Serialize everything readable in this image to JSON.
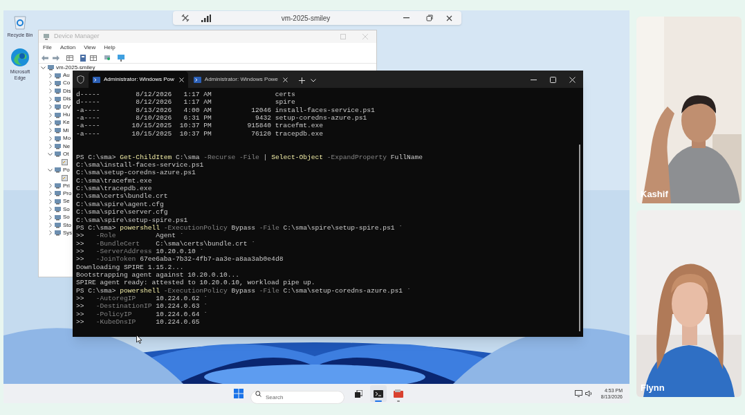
{
  "remote_bar": {
    "title": "vm-2025-smiley"
  },
  "desktop_icons": [
    {
      "kind": "recycle",
      "label": "Recycle Bin"
    },
    {
      "kind": "browser",
      "label": "Microsoft Edge"
    }
  ],
  "device_manager": {
    "title": "Device Manager",
    "menu": [
      "File",
      "Action",
      "View",
      "Help"
    ],
    "tree": {
      "label": "vm-2025-smiley",
      "expanded": true,
      "children": [
        {
          "label": "Au",
          "expanded": false
        },
        {
          "label": "Co",
          "expanded": false
        },
        {
          "label": "Dis",
          "expanded": false
        },
        {
          "label": "Dis",
          "expanded": false
        },
        {
          "label": "DV",
          "expanded": false
        },
        {
          "label": "Hu",
          "expanded": false
        },
        {
          "label": "Ke",
          "expanded": false
        },
        {
          "label": "Mi",
          "expanded": false
        },
        {
          "label": "Mo",
          "expanded": false
        },
        {
          "label": "Ne",
          "expanded": false
        },
        {
          "label": "Ot",
          "expanded": true,
          "children": [
            {
              "kind": "device"
            }
          ]
        },
        {
          "label": "Po",
          "expanded": true,
          "children": [
            {
              "kind": "device"
            }
          ]
        },
        {
          "label": "Pri",
          "expanded": false
        },
        {
          "label": "Pro",
          "expanded": false
        },
        {
          "label": "Se",
          "expanded": false
        },
        {
          "label": "So",
          "expanded": false
        },
        {
          "label": "So",
          "expanded": false
        },
        {
          "label": "Sto",
          "expanded": false
        },
        {
          "label": "Sys",
          "expanded": false
        }
      ]
    }
  },
  "terminal": {
    "tabs": [
      {
        "label": "Administrator: Windows Pow",
        "selected": true
      },
      {
        "label": "Administrator: Windows Powe",
        "selected": false
      }
    ],
    "lines": [
      {
        "kind": "output",
        "text": "d-----         8/12/2026   1:17 AM                certs"
      },
      {
        "kind": "output",
        "text": "d-----         8/12/2026   1:17 AM                spire"
      },
      {
        "kind": "output",
        "text": "-a----         8/13/2026   4:00 AM          12046 install-faces-service.ps1"
      },
      {
        "kind": "output",
        "text": "-a----         8/10/2026   6:31 PM           9432 setup-coredns-azure.ps1"
      },
      {
        "kind": "output",
        "text": "-a----        10/15/2025  10:37 PM         915840 tracefmt.exe"
      },
      {
        "kind": "output",
        "text": "-a----        10/15/2025  10:37 PM          76120 tracepdb.exe"
      },
      {
        "kind": "blank"
      },
      {
        "kind": "blank"
      },
      {
        "kind": "command",
        "segments": [
          {
            "text": "PS C:\\sma> ",
            "kind": "plain"
          },
          {
            "text": "Get-ChildItem",
            "kind": "cmd"
          },
          {
            "text": " C:\\sma ",
            "kind": "plain"
          },
          {
            "text": "-Recurse -File",
            "kind": "param"
          },
          {
            "text": " | ",
            "kind": "plain"
          },
          {
            "text": "Select-Object",
            "kind": "cmd"
          },
          {
            "text": " -ExpandProperty",
            "kind": "param"
          },
          {
            "text": " FullName",
            "kind": "plain"
          }
        ]
      },
      {
        "kind": "output",
        "text": "C:\\sma\\install-faces-service.ps1"
      },
      {
        "kind": "output",
        "text": "C:\\sma\\setup-coredns-azure.ps1"
      },
      {
        "kind": "output",
        "text": "C:\\sma\\tracefmt.exe"
      },
      {
        "kind": "output",
        "text": "C:\\sma\\tracepdb.exe"
      },
      {
        "kind": "output",
        "text": "C:\\sma\\certs\\bundle.crt"
      },
      {
        "kind": "output",
        "text": "C:\\sma\\spire\\agent.cfg"
      },
      {
        "kind": "output",
        "text": "C:\\sma\\spire\\server.cfg"
      },
      {
        "kind": "output",
        "text": "C:\\sma\\spire\\setup-spire.ps1"
      },
      {
        "kind": "command",
        "segments": [
          {
            "text": "PS C:\\sma> ",
            "kind": "plain"
          },
          {
            "text": "powershell",
            "kind": "cmd"
          },
          {
            "text": " -ExecutionPolicy",
            "kind": "param"
          },
          {
            "text": " Bypass ",
            "kind": "plain"
          },
          {
            "text": "-File",
            "kind": "param"
          },
          {
            "text": " C:\\sma\\spire\\setup-spire.ps1 `",
            "kind": "plain"
          }
        ]
      },
      {
        "kind": "command",
        "segments": [
          {
            "text": ">>   ",
            "kind": "plain"
          },
          {
            "text": "-Role",
            "kind": "param"
          },
          {
            "text": "          Agent `",
            "kind": "plain"
          }
        ]
      },
      {
        "kind": "command",
        "segments": [
          {
            "text": ">>   ",
            "kind": "plain"
          },
          {
            "text": "-BundleCert",
            "kind": "param"
          },
          {
            "text": "    C:\\sma\\certs\\bundle.crt `",
            "kind": "plain"
          }
        ]
      },
      {
        "kind": "command",
        "segments": [
          {
            "text": ">>   ",
            "kind": "plain"
          },
          {
            "text": "-ServerAddress",
            "kind": "param"
          },
          {
            "text": " 10.20.0.10 `",
            "kind": "plain"
          }
        ]
      },
      {
        "kind": "command",
        "segments": [
          {
            "text": ">>   ",
            "kind": "plain"
          },
          {
            "text": "-JoinToken",
            "kind": "param"
          },
          {
            "text": " 67ee6aba-7b32-4fb7-aa3e-a8aa3ab0e4d8",
            "kind": "plain"
          }
        ]
      },
      {
        "kind": "output",
        "text": "Downloading SPIRE 1.15.2..."
      },
      {
        "kind": "output",
        "text": "Bootstrapping agent against 10.20.0.10..."
      },
      {
        "kind": "output",
        "text": "SPIRE agent ready: attested to 10.20.0.10, workload pipe up."
      },
      {
        "kind": "command",
        "segments": [
          {
            "text": "PS C:\\sma> ",
            "kind": "plain"
          },
          {
            "text": "powershell",
            "kind": "cmd"
          },
          {
            "text": " -ExecutionPolicy",
            "kind": "param"
          },
          {
            "text": " Bypass ",
            "kind": "plain"
          },
          {
            "text": "-File",
            "kind": "param"
          },
          {
            "text": " C:\\sma\\setup-coredns-azure.ps1 `",
            "kind": "plain"
          }
        ]
      },
      {
        "kind": "command",
        "segments": [
          {
            "text": ">>   ",
            "kind": "plain"
          },
          {
            "text": "-AutoregIP",
            "kind": "param"
          },
          {
            "text": "     10.224.0.62 `",
            "kind": "plain"
          }
        ]
      },
      {
        "kind": "command",
        "segments": [
          {
            "text": ">>   ",
            "kind": "plain"
          },
          {
            "text": "-DestinationIP",
            "kind": "param"
          },
          {
            "text": " 10.224.0.63 `",
            "kind": "plain"
          }
        ]
      },
      {
        "kind": "command",
        "segments": [
          {
            "text": ">>   ",
            "kind": "plain"
          },
          {
            "text": "-PolicyIP",
            "kind": "param"
          },
          {
            "text": "      10.224.0.64 `",
            "kind": "plain"
          }
        ]
      },
      {
        "kind": "command",
        "segments": [
          {
            "text": ">>   ",
            "kind": "plain"
          },
          {
            "text": "-KubeDnsIP",
            "kind": "param"
          },
          {
            "text": "     10.224.0.65",
            "kind": "plain"
          }
        ]
      }
    ]
  },
  "taskbar": {
    "search": {
      "placeholder": "Search"
    },
    "apps": [
      {
        "kind": "task-view",
        "selected": false,
        "open": false
      },
      {
        "kind": "terminal",
        "selected": true,
        "open": true
      },
      {
        "kind": "app",
        "selected": false,
        "open": true
      }
    ],
    "time": "4:53 PM",
    "date": "8/13/2026"
  },
  "participants": [
    {
      "kind": "short-hair",
      "name": "Kashif"
    },
    {
      "kind": "long-hair",
      "name": "Flynn"
    }
  ]
}
